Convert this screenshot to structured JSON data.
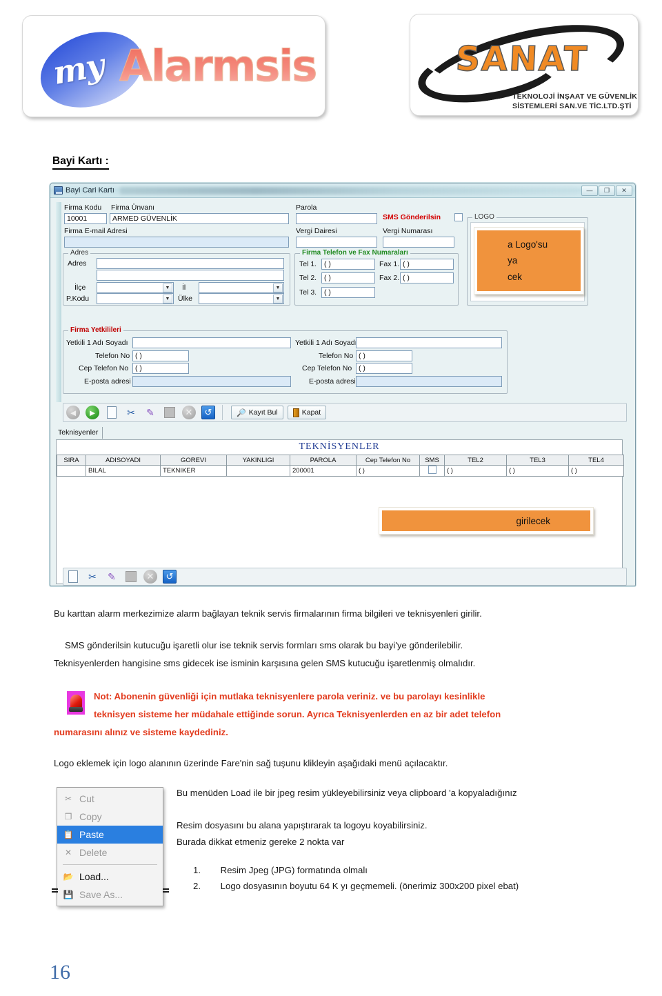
{
  "header": {
    "logo_left": {
      "name": "myAlarmsis",
      "part_my": "my",
      "part_alarmsis": "Alarmsis"
    },
    "logo_right": {
      "name": "SANAT",
      "subtitle_line1": "TEKNOLOJİ İNŞAAT VE GÜVENLİK",
      "subtitle_line2": "SİSTEMLERİ SAN.VE TİC.LTD.ŞTİ"
    }
  },
  "section_title": "Bayi Kartı :",
  "window": {
    "title": "Bayi Cari Kartı",
    "buttons": {
      "minimize": "—",
      "maximize": "❐",
      "close": "✕"
    },
    "form": {
      "firma_kodu_label": "Firma Kodu",
      "firma_kodu_value": "10001",
      "firma_unvani_label": "Firma Ünvanı",
      "firma_unvani_value": "ARMED GÜVENLİK",
      "firma_email_label": "Firma E-mail Adresi",
      "firma_email_value": "",
      "parola_label": "Parola",
      "parola_value": "",
      "sms_gonderilsin_label": "SMS Gönderilsin",
      "vergi_dairesi_label": "Vergi Dairesi",
      "vergi_dairesi_value": "",
      "vergi_numarasi_label": "Vergi Numarası",
      "vergi_numarasi_value": "",
      "adres_group": "Adres",
      "adres_label": "Adres",
      "adres_value": "",
      "adres_value2": "",
      "ilce_label": "İlçe",
      "ilce_value": "",
      "il_label": "İl",
      "il_value": "",
      "pkodu_label": "P.Kodu",
      "pkodu_value": "",
      "ulke_label": "Ülke",
      "ulke_value": "",
      "telefon_group": "Firma Telefon ve Fax Numaraları",
      "tel1_label": "Tel 1.",
      "tel1_value": "(    )",
      "tel2_label": "Tel 2.",
      "tel2_value": "(    )",
      "tel3_label": "Tel 3.",
      "tel3_value": "(    )",
      "fax1_label": "Fax 1.",
      "fax1_value": "(    )",
      "fax2_label": "Fax 2.",
      "fax2_value": "(    )",
      "logo_group": "LOGO",
      "yetkililer_group": "Firma Yetkilileri",
      "yetkili1_label": "Yetkili 1 Adı Soyadı",
      "yetkili1_value": "",
      "yetkili_telefon_label": "Telefon No",
      "yetkili_telefon_value": "(    )",
      "yetkili_cep_label": "Cep Telefon No",
      "yetkili_cep_value": "(    )",
      "yetkili_eposta_label": "E-posta adresi",
      "yetkili_eposta_value": "",
      "yetkili2_label": "Yetkili 1 Adı Soyadı",
      "yetkili2_value": "",
      "yetkili2_telefon_label": "Telefon No",
      "yetkili2_telefon_value": "(    )",
      "yetkili2_cep_label": "Cep Telefon No",
      "yetkili2_cep_value": "(    )",
      "yetkili2_eposta_label": "E-posta adresi",
      "yetkili2_eposta_value": ""
    },
    "toolbar": {
      "kayit_bul": "Kayıt Bul",
      "kapat": "Kapat"
    },
    "tab_teknisyenler": "Teknisyenler",
    "grid": {
      "title": "TEKNİSYENLER",
      "columns": [
        "SIRA",
        "ADISOYADI",
        "GOREVI",
        "YAKINLIGI",
        "PAROLA",
        "Cep Telefon No",
        "SMS",
        "TEL2",
        "TEL3",
        "TEL4"
      ],
      "rows": [
        {
          "SIRA": "",
          "ADISOYADI": "BILAL",
          "GOREVI": "TEKNIKER",
          "YAKINLIGI": "",
          "PAROLA": "200001",
          "Cep Telefon No": "(    )",
          "SMS": "",
          "TEL2": "(    )",
          "TEL3": "(    )",
          "TEL4": "(    )"
        }
      ]
    },
    "callouts": {
      "logo_box_lines": [
        "a Logo'su",
        "ya",
        "cek"
      ],
      "grid_box_text": "girilecek",
      "accent_color": "#f0933d"
    }
  },
  "body": {
    "p1": "Bu karttan alarm merkezimize alarm bağlayan teknik servis firmalarının firma bilgileri ve teknisyenleri girilir.",
    "p2": "SMS gönderilsin kutucuğu işaretli olur ise teknik servis formları sms olarak bu bayi'ye gönderilebilir.",
    "p3": "Teknisyenlerden hangisine sms gidecek ise isminin karşısına gelen SMS kutucuğu işaretlenmiş olmalıdır.",
    "note_line1": "Not:  Abonenin güvenliği için mutlaka teknisyenlere parola veriniz. ve bu parolayı kesinlikle",
    "note_line2": "teknisyen sisteme her müdahale ettiğinde sorun. Ayrıca Teknisyenlerden en az bir adet telefon",
    "note_line3": "numarasını alınız ve sisteme kaydediniz.",
    "note_color": "#e23b1e",
    "p4": "Logo eklemek için logo alanının üzerinde Fare'nin sağ tuşunu klikleyin aşağıdaki menü açılacaktır.",
    "p5": "Bu menüden Load ile bir jpeg resim yükleyebilirsiniz veya clipboard 'a kopyaladığınız",
    "p6": "Resim dosyasını bu alana yapıştırarak ta logoyu koyabilirsiniz.",
    "p7": "Burada dikkat etmeniz gereke 2 nokta var",
    "list": [
      {
        "num": "1.",
        "text": "Resim Jpeg (JPG) formatında olmalı"
      },
      {
        "num": "2.",
        "text": "Logo dosyasının boyutu 64 K yı geçmemeli. (önerimiz 300x200 pixel ebat)"
      }
    ]
  },
  "context_menu": {
    "items": [
      {
        "label": "Cut",
        "icon": "scissors-icon",
        "state": "disabled"
      },
      {
        "label": "Copy",
        "icon": "copy-icon",
        "state": "disabled"
      },
      {
        "label": "Paste",
        "icon": "clipboard-icon",
        "state": "selected"
      },
      {
        "label": "Delete",
        "icon": "delete-x-icon",
        "state": "disabled"
      },
      {
        "label": "Load...",
        "icon": "folder-open-icon",
        "state": "enabled"
      },
      {
        "label": "Save As...",
        "icon": "floppy-disk-icon",
        "state": "disabled"
      }
    ]
  },
  "page_number": "16"
}
